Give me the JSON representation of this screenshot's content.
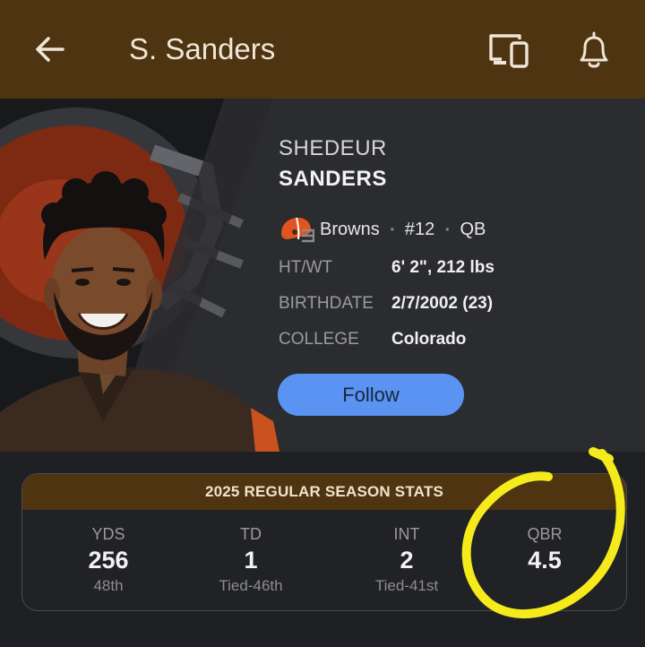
{
  "header": {
    "title": "S. Sanders",
    "bg_color": "#4e3410",
    "icons": [
      "arrow-back-icon",
      "cast-devices-icon",
      "bell-icon"
    ]
  },
  "player": {
    "first_name": "SHEDEUR",
    "last_name": "SANDERS",
    "team": "Browns",
    "number": "#12",
    "position": "QB",
    "separator": "•",
    "details": [
      {
        "label": "HT/WT",
        "value": "6' 2\", 212 lbs"
      },
      {
        "label": "BIRTHDATE",
        "value": "2/7/2002 (23)"
      },
      {
        "label": "COLLEGE",
        "value": "Colorado"
      }
    ],
    "follow_label": "Follow",
    "follow_color": "#5b93f2"
  },
  "stats": {
    "title": "2025 REGULAR SEASON STATS",
    "items": [
      {
        "label": "YDS",
        "value": "256",
        "rank": "48th"
      },
      {
        "label": "TD",
        "value": "1",
        "rank": "Tied-46th"
      },
      {
        "label": "INT",
        "value": "2",
        "rank": "Tied-41st"
      },
      {
        "label": "QBR",
        "value": "4.5",
        "rank": ""
      }
    ]
  },
  "annotation": {
    "color": "#f4ea1c"
  }
}
